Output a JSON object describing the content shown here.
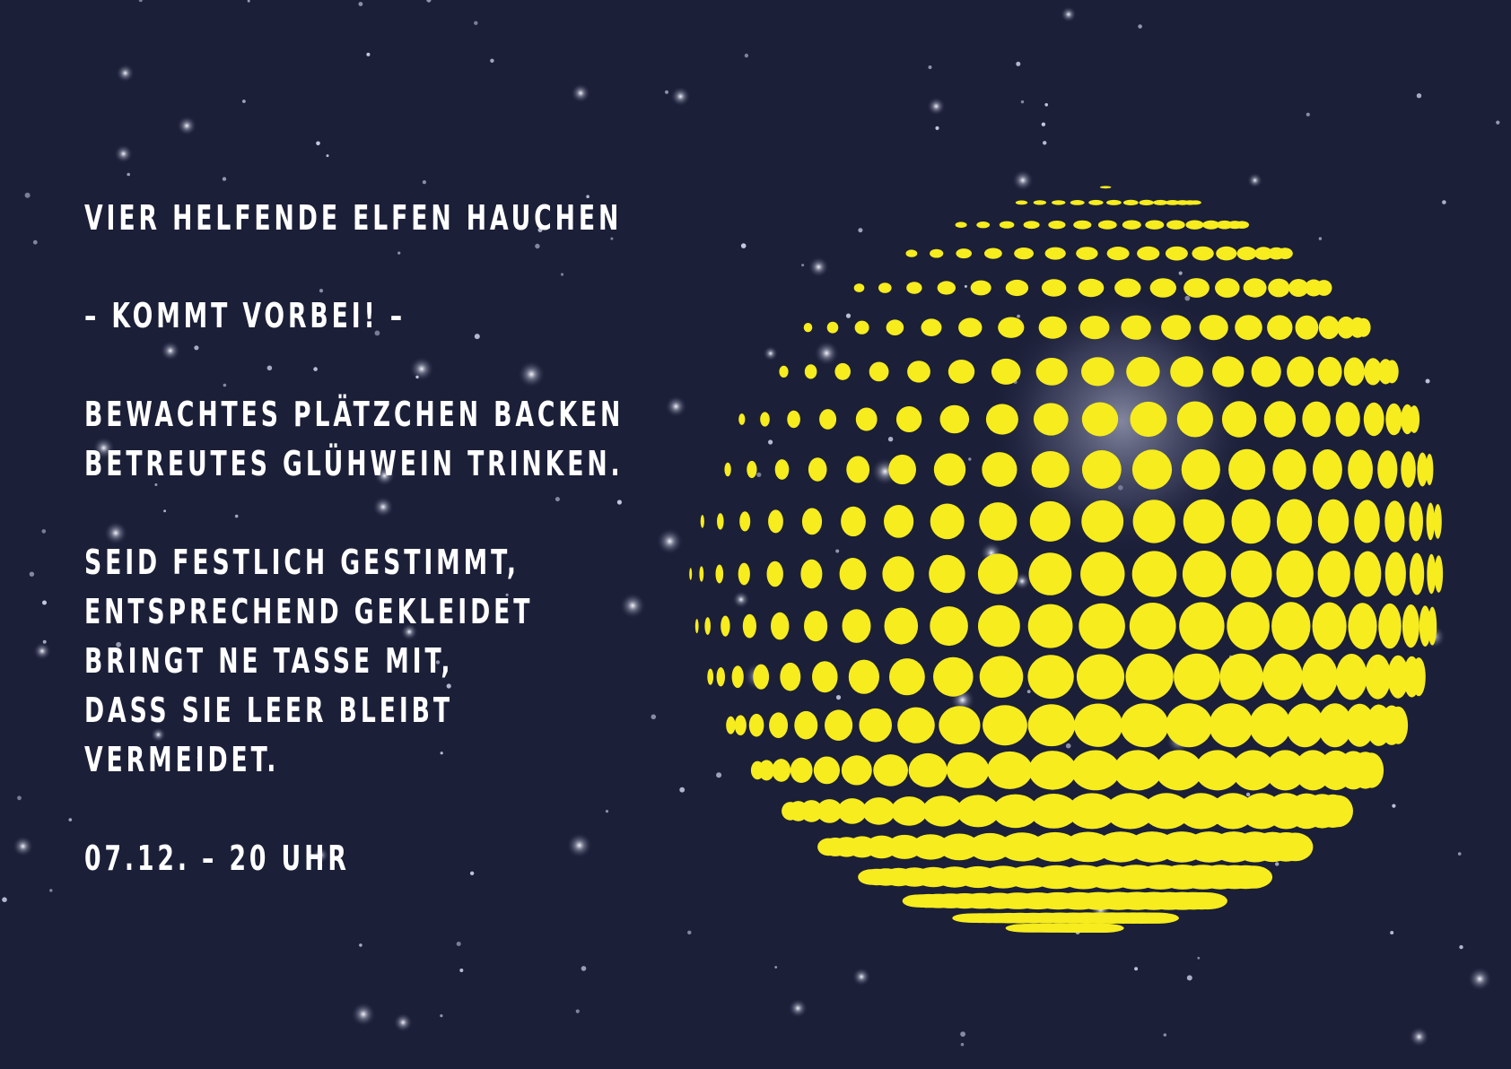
{
  "invitation": {
    "headline": "VIER HELFENDE ELFEN HAUCHEN",
    "callout": "– KOMMT VORBEI! –",
    "activities": [
      "BEWACHTES PLÄTZCHEN BACKEN",
      "BETREUTES GLÜHWEIN TRINKEN."
    ],
    "instructions": [
      "SEID FESTLICH GESTIMMT,",
      "ENTSPRECHEND GEKLEIDET",
      "BRINGT NE TASSE MIT,",
      "DASS SIE LEER BLEIBT",
      "VERMEIDET."
    ],
    "date_time": "07.12. – 20 UHR"
  },
  "graphics": {
    "background_color": "#1b1f38",
    "accent_color": "#f7ec1e",
    "text_color": "#ffffff",
    "sphere": "halftone-dot-sphere",
    "backdrop": "starry-sky"
  }
}
